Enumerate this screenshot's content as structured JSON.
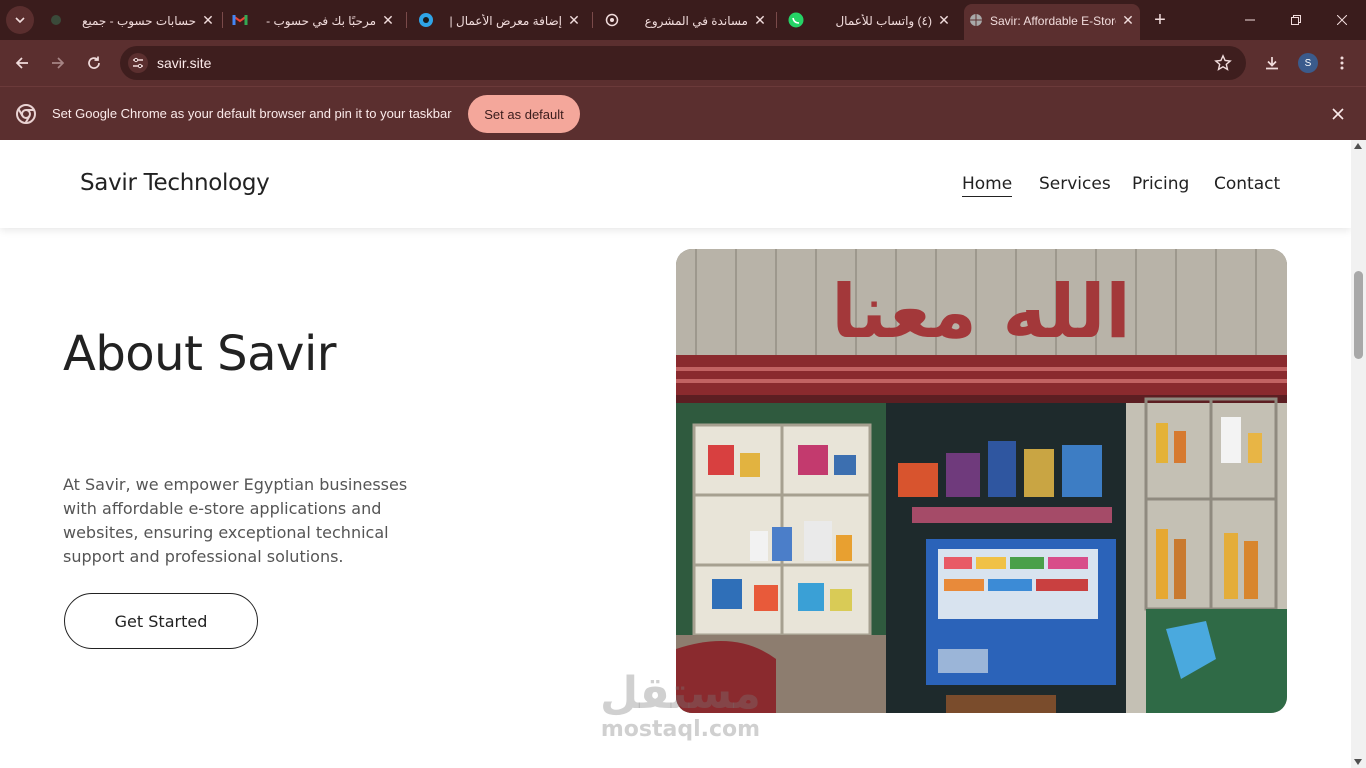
{
  "browser": {
    "tabs": [
      {
        "title": "حسابات حسوب - جميع",
        "icon": "generic-icon"
      },
      {
        "title": "مرحبًا بك في حسوب -",
        "icon": "gmail-icon"
      },
      {
        "title": "إضافة معرض الأعمال |",
        "icon": "mostaql-icon"
      },
      {
        "title": "مساندة في المشروع",
        "icon": "chatgpt-icon"
      },
      {
        "title": "(٤) واتساب للأعمال",
        "icon": "whatsapp-icon"
      },
      {
        "title": "Savir: Affordable E-Store",
        "icon": "globe-icon",
        "active": true
      }
    ],
    "url": "savir.site",
    "profile_initial": "S",
    "infobar": {
      "message": "Set Google Chrome as your default browser and pin it to your taskbar",
      "button": "Set as default"
    },
    "colors": {
      "frame": "#3a1c1c",
      "toolbar": "#5b2f2f",
      "accent": "#f4a79b"
    }
  },
  "site": {
    "brand": "Savir Technology",
    "nav": [
      {
        "label": "Home",
        "active": true
      },
      {
        "label": "Services",
        "active": false
      },
      {
        "label": "Pricing",
        "active": false
      },
      {
        "label": "Contact",
        "active": false
      }
    ],
    "about": {
      "title": "About Savir",
      "text": "At Savir, we empower Egyptian businesses with affordable e-store applications and websites, ensuring exceptional technical support and professional solutions.",
      "cta": "Get Started"
    },
    "hero_image": {
      "sign_text": "الله معنا"
    },
    "watermark": {
      "logo": "مستقل",
      "text": "mostaql.com"
    }
  }
}
